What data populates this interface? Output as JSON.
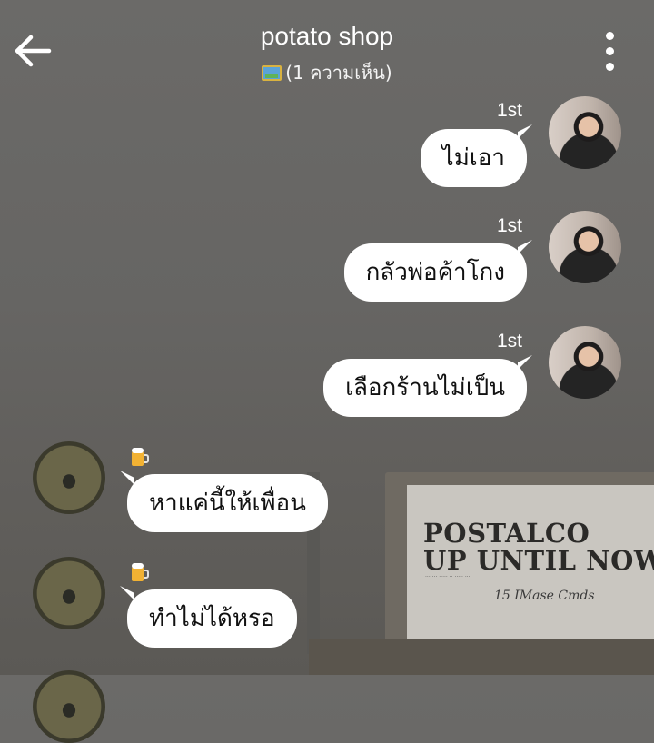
{
  "header": {
    "title": "potato shop",
    "subtitle": "(1 ความเห็น)",
    "back_icon": "arrow-left-icon",
    "menu_icon": "more-vertical-icon"
  },
  "background": {
    "poster_line1": "POSTALCO",
    "poster_line2": "UP UNTIL NOW",
    "poster_signature": "15 IMase Cmds"
  },
  "messages": [
    {
      "side": "right",
      "badge": "1st",
      "text": "ไม่เอา"
    },
    {
      "side": "right",
      "badge": "1st",
      "text": "กลัวพ่อค้าโกง"
    },
    {
      "side": "right",
      "badge": "1st",
      "text": "เลือกร้านไม่เป็น"
    },
    {
      "side": "left",
      "badge_icon": "beer-mug-icon",
      "text": "หาแค่นี้ให้เพื่อน"
    },
    {
      "side": "left",
      "badge_icon": "beer-mug-icon",
      "text": "ทำไม่ได้หรอ"
    }
  ],
  "colors": {
    "bubble": "#ffffff",
    "text": "#111111",
    "background": "#666563"
  }
}
